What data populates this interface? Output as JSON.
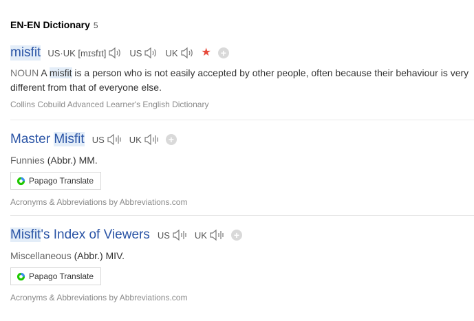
{
  "header": {
    "title": "EN-EN Dictionary",
    "count": "5"
  },
  "entries": [
    {
      "word": "misfit",
      "phonetic": "US·UK [mɪsfɪt]",
      "us_label": "US",
      "uk_label": "UK",
      "pos": "NOUN",
      "definition_pre": "A",
      "definition_word": "misfit",
      "definition_post": "is a person who is not easily accepted by other people, often because their behaviour is very different from that of everyone else.",
      "source": "Collins Cobuild Advanced Learner's English Dictionary"
    },
    {
      "word_hl": "Misfit",
      "word_pre": "Master",
      "us_label": "US",
      "uk_label": "UK",
      "category": "Funnies",
      "abbr": "(Abbr.) MM.",
      "papago_label": "Papago Translate",
      "source": "Acronyms & Abbreviations by Abbreviations.com"
    },
    {
      "word_hl": "Misfit",
      "word_post": "'s Index of Viewers",
      "us_label": "US",
      "uk_label": "UK",
      "category": "Miscellaneous",
      "abbr": "(Abbr.) MIV.",
      "papago_label": "Papago Translate",
      "source": "Acronyms & Abbreviations by Abbreviations.com"
    }
  ],
  "colors": {
    "link": "#2953a5",
    "highlight": "#e3edf8",
    "star": "#e64a3b"
  },
  "icons": [
    "speaker-icon",
    "speaker-bars-icon",
    "star-icon",
    "plus-icon",
    "papago-icon"
  ]
}
